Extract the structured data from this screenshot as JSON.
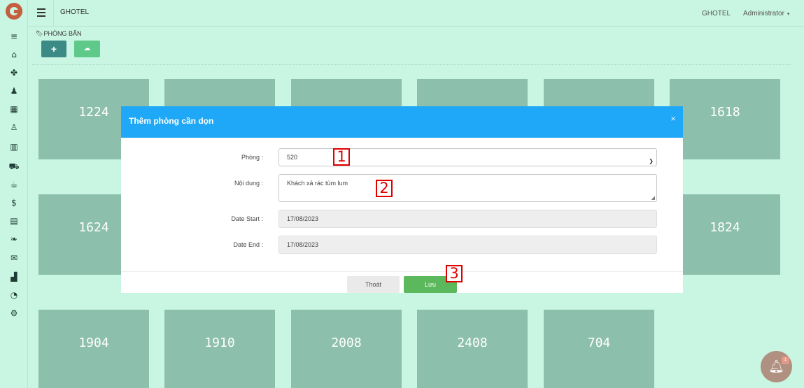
{
  "header": {
    "brand": "GHOTEL",
    "brand_right": "GHOTEL",
    "user": "Administrator",
    "user_caret": "▾"
  },
  "page": {
    "breadcrumb": "PHÒNG BẨN",
    "add_label": "+",
    "upload_label": "☁"
  },
  "sidebar": {
    "icons": [
      "menu-icon",
      "home-icon",
      "handshake-icon",
      "user-tie-icon",
      "building-icon",
      "users-icon",
      "grid-icon",
      "cart-icon",
      "coffee-icon",
      "dollar-icon",
      "table-icon",
      "leaf-icon",
      "mail-icon",
      "chart-icon",
      "chat-icon",
      "settings-icon"
    ]
  },
  "rooms": [
    "1224",
    "1618",
    "1624",
    "1824",
    "1904",
    "1910",
    "2008",
    "2408",
    "704"
  ],
  "modal": {
    "title": "Thêm phòng cần dọn",
    "close": "×",
    "room_label": "Phòng :",
    "room_value": "520",
    "content_label": "Nội dung :",
    "content_value": "Khách xả rác tùm lum",
    "start_label": "Date Start :",
    "start_value": "17/08/2023",
    "end_label": "Date End :",
    "end_value": "17/08/2023",
    "exit_label": "Thoát",
    "save_label": "Lưu"
  },
  "markers": [
    "1",
    "2",
    "3"
  ],
  "notification": {
    "badge": "1"
  },
  "colors": {
    "accent": "#1fa8f7",
    "room_tile": "#8dbfad",
    "background": "#c9f5e3",
    "save": "#5cb85c"
  }
}
